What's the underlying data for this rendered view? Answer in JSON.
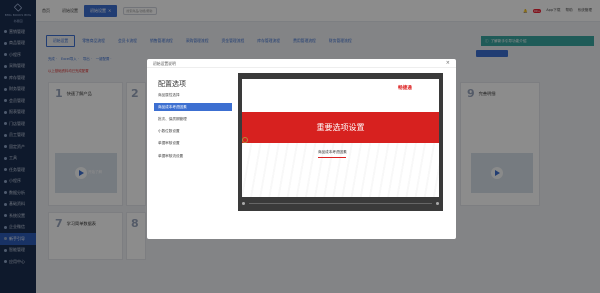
{
  "sidebar": {
    "logo_text": "BMG BOOKS BMG",
    "logo_sub": "书香园",
    "items": [
      {
        "label": "营销管理",
        "active": false
      },
      {
        "label": "商品管理",
        "active": false
      },
      {
        "label": "小程序",
        "active": false
      },
      {
        "label": "采购管理",
        "active": false
      },
      {
        "label": "库存管理",
        "active": false
      },
      {
        "label": "财务管理",
        "active": false
      },
      {
        "label": "会员管理",
        "active": false
      },
      {
        "label": "报表管理",
        "active": false
      },
      {
        "label": "门店管理",
        "active": false
      },
      {
        "label": "员工管理",
        "active": false
      },
      {
        "label": "固定资产",
        "active": false
      },
      {
        "label": "工具",
        "active": false
      },
      {
        "label": "任务管理",
        "active": false
      },
      {
        "label": "小程序",
        "active": false
      },
      {
        "label": "数据分析",
        "active": false
      },
      {
        "label": "基础资料",
        "active": false
      },
      {
        "label": "系统设置",
        "active": false
      },
      {
        "label": "企业微信",
        "active": false
      },
      {
        "label": "新手引导",
        "active": true
      },
      {
        "label": "智能管理",
        "active": false
      },
      {
        "label": "应用中心",
        "active": false
      }
    ]
  },
  "topbar": {
    "items": [
      {
        "label": "首页"
      },
      {
        "label": "初始设置"
      }
    ],
    "active_tab": "初始设置",
    "search_placeholder": "搜索商品/功能/帮助",
    "right": {
      "notify_label": "消息",
      "notify_count": "99+",
      "app_label": "App下载",
      "help_label": "帮助",
      "user_label": "系统管理"
    }
  },
  "subtabs": [
    {
      "label": "初始设置",
      "active": true
    },
    {
      "label": "零售商品流程",
      "active": false
    },
    {
      "label": "会员卡流程",
      "active": false
    },
    {
      "label": "销售管理流程",
      "active": false
    },
    {
      "label": "采购管理流程",
      "active": false
    },
    {
      "label": "资金管理流程",
      "active": false
    },
    {
      "label": "库存管理流程",
      "active": false
    },
    {
      "label": "费用管理流程",
      "active": false
    },
    {
      "label": "财务管理流程",
      "active": false
    }
  ],
  "notice": {
    "text": "了解新手引导功能介绍",
    "link": "一键配置"
  },
  "filters": [
    "完成 ·",
    "Excel导入 ·",
    "导出 ·",
    "一键配置 ·"
  ],
  "warning": "以上基础资料均已完成配置",
  "cards": [
    {
      "num": "1",
      "title": "快速了解产品"
    },
    {
      "num": "2",
      "title": ""
    },
    {
      "num": "7",
      "title": "学习简单数据表"
    },
    {
      "num": "8",
      "title": ""
    },
    {
      "num": "9",
      "title": "完善明细"
    }
  ],
  "video_label": "开始了解",
  "modal": {
    "title": "初始设置说明",
    "menu_title": "配置选项",
    "menu_items": [
      {
        "label": "商品属性选择",
        "active": false
      },
      {
        "label": "商品成本考虑因素",
        "active": true
      },
      {
        "label": "批次、保质期管理",
        "active": false
      },
      {
        "label": "小数位数设置",
        "active": false
      },
      {
        "label": "单据审核设置",
        "active": false
      },
      {
        "label": "单据审核流设置",
        "active": false
      }
    ],
    "preview": {
      "brand": "畅捷通",
      "banner": "重要选项设置",
      "subtitle": "商品成本考虑因素"
    }
  }
}
